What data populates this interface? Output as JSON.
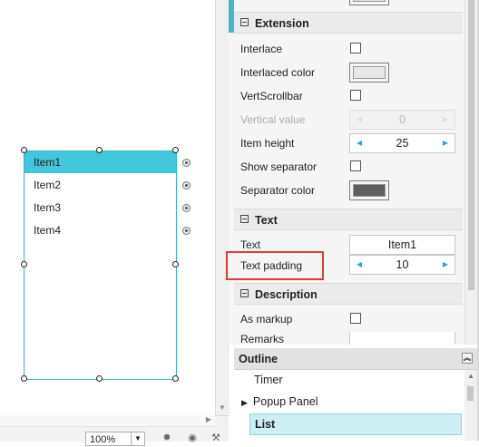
{
  "canvas": {
    "list_items": [
      "Item1",
      "Item2",
      "Item3",
      "Item4"
    ],
    "selected_index": 0
  },
  "statusbar": {
    "zoom": "100%"
  },
  "properties": {
    "sections": {
      "extension": "Extension",
      "text": "Text",
      "description": "Description"
    },
    "interlace": {
      "label": "Interlace",
      "checked": false
    },
    "interlaced_color": {
      "label": "Interlaced color",
      "color": "#e8e8e8"
    },
    "vert_scrollbar": {
      "label": "VertScrollbar",
      "checked": false
    },
    "vertical_value": {
      "label": "Vertical value",
      "value": "0",
      "enabled": false
    },
    "item_height": {
      "label": "Item height",
      "value": "25"
    },
    "show_separator": {
      "label": "Show separator",
      "checked": false
    },
    "separator_color": {
      "label": "Separator color",
      "color": "#5f5f5f"
    },
    "text": {
      "label": "Text",
      "value": "Item1"
    },
    "text_padding": {
      "label": "Text padding",
      "value": "10"
    },
    "as_markup": {
      "label": "As markup",
      "checked": false
    },
    "remarks": {
      "label": "Remarks",
      "value": ""
    }
  },
  "outline": {
    "title": "Outline",
    "items": [
      {
        "label": "Timer",
        "expandable": false,
        "selected": false
      },
      {
        "label": "Popup Panel",
        "expandable": true,
        "selected": false
      },
      {
        "label": "List",
        "expandable": false,
        "selected": true
      }
    ]
  },
  "colors": {
    "accent": "#42c6db",
    "highlight": "#e53b3b",
    "selection": "#cdeef3"
  },
  "icons": [
    "spin-left-icon",
    "spin-right-icon",
    "collapse-icon",
    "expand-arrow-icon",
    "scroll-arrow-icon"
  ]
}
